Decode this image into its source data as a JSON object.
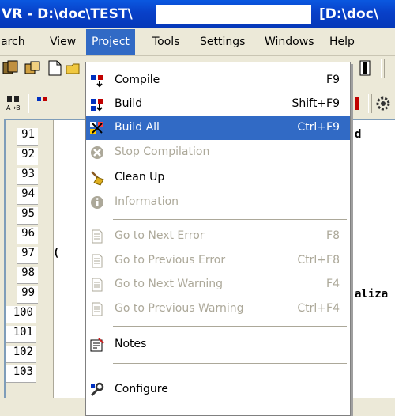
{
  "window": {
    "title_left": "VR - D:\\doc\\TEST\\",
    "title_right": "[D:\\doc\\"
  },
  "menubar": {
    "items": [
      {
        "label": "arch"
      },
      {
        "label": "View"
      },
      {
        "label": "Project"
      },
      {
        "label": "Tools"
      },
      {
        "label": "Settings"
      },
      {
        "label": "Windows"
      },
      {
        "label": "Help"
      }
    ]
  },
  "project_menu": {
    "items": [
      {
        "label": "Compile",
        "shortcut": "F9",
        "icon": "compile-icon",
        "enabled": true
      },
      {
        "label": "Build",
        "shortcut": "Shift+F9",
        "icon": "build-icon",
        "enabled": true
      },
      {
        "label": "Build All",
        "shortcut": "Ctrl+F9",
        "icon": "build-all-icon",
        "enabled": true,
        "highlighted": true
      },
      {
        "label": "Stop Compilation",
        "shortcut": "",
        "icon": "stop-icon",
        "enabled": false
      },
      {
        "label": "Clean Up",
        "shortcut": "",
        "icon": "broom-icon",
        "enabled": true
      },
      {
        "label": "Information",
        "shortcut": "",
        "icon": "info-icon",
        "enabled": false
      },
      {
        "label": "Go to Next Error",
        "shortcut": "F8",
        "icon": "document-icon",
        "enabled": false
      },
      {
        "label": "Go to Previous Error",
        "shortcut": "Ctrl+F8",
        "icon": "document-icon",
        "enabled": false
      },
      {
        "label": "Go to Next Warning",
        "shortcut": "F4",
        "icon": "document-icon",
        "enabled": false
      },
      {
        "label": "Go to Previous Warning",
        "shortcut": "Ctrl+F4",
        "icon": "document-icon",
        "enabled": false
      },
      {
        "label": "Notes",
        "shortcut": "",
        "icon": "notes-icon",
        "enabled": true
      },
      {
        "label": "Configure",
        "shortcut": "",
        "icon": "configure-icon",
        "enabled": true
      }
    ]
  },
  "editor": {
    "line_numbers": [
      "91",
      "92",
      "93",
      "94",
      "95",
      "96",
      "97",
      "98",
      "99",
      "100",
      "101",
      "102",
      "103"
    ],
    "code_fragments": {
      "line91": "d",
      "line97_prefix": "(",
      "line99": "aliza"
    }
  },
  "colors": {
    "title_bar": "#0840c8",
    "menu_highlight": "#316ac5",
    "disabled_text": "#aca899",
    "face": "#ece9d8"
  }
}
